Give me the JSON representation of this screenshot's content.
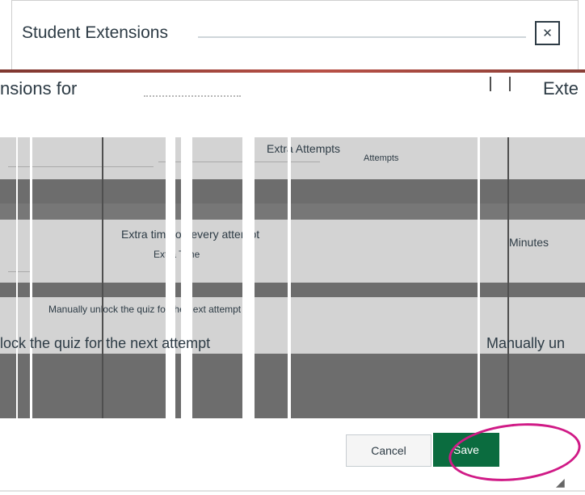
{
  "dialog": {
    "title": "Student Extensions",
    "close_icon": "close-icon"
  },
  "header": {
    "extensions_for_text": "nsions for",
    "extensions_right_text": "Exte"
  },
  "panel": {
    "extra_attempts_label": "Extra Attempts",
    "extra_attempts_sub": "Attempts",
    "time_label": "Extra time on every attempt",
    "time_sub": "Extra Time",
    "minutes_label": "Minutes",
    "manual_unlock_text": "Manually unlock the quiz for the next attempt",
    "lock_text": "lock the quiz for the next attempt",
    "manually_text": "Manually un"
  },
  "footer": {
    "cancel_label": "Cancel",
    "save_label": "Save",
    "resize_icon": "resize-handle-icon"
  }
}
